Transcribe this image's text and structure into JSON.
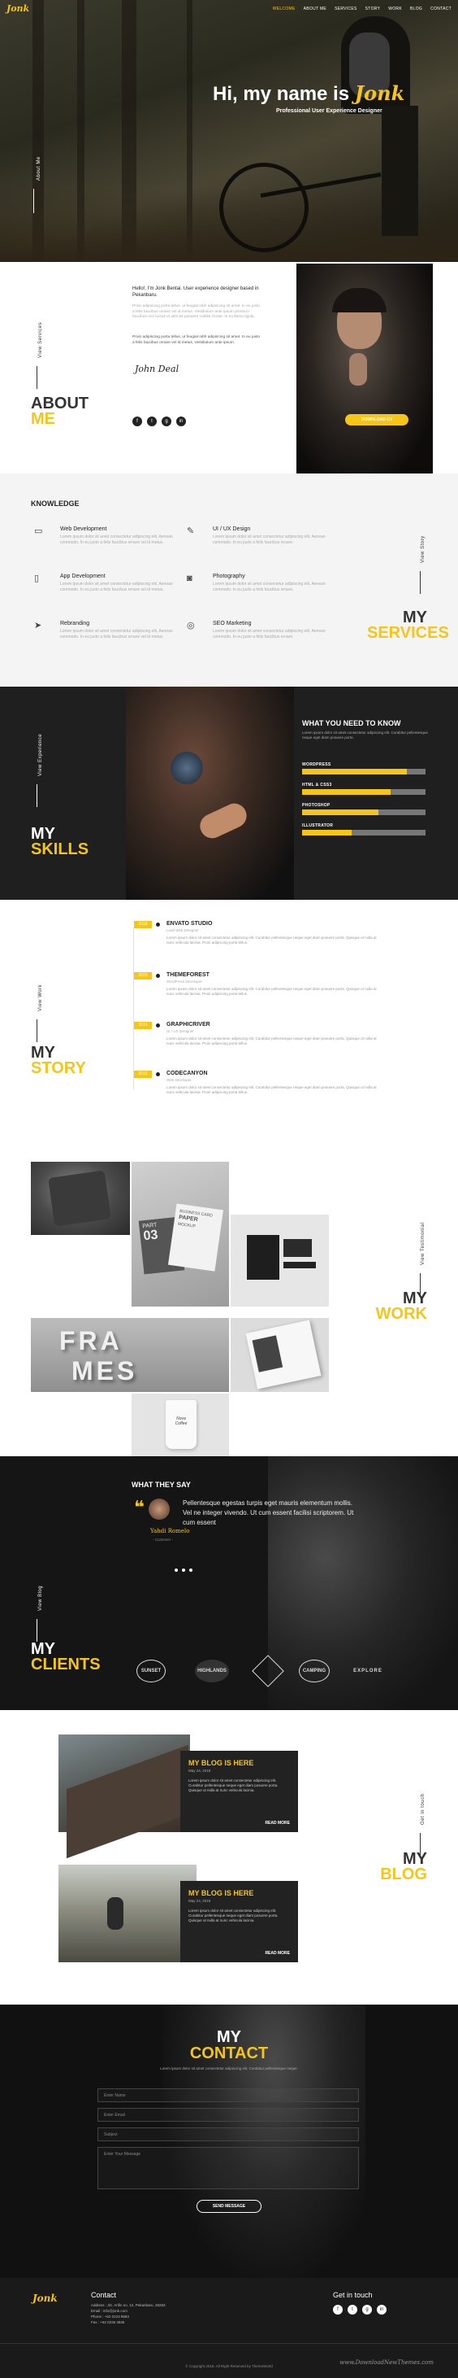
{
  "nav": {
    "logo": "Jonk",
    "items": [
      "WELCOME",
      "ABOUT ME",
      "SERVICES",
      "STORY",
      "WORK",
      "BLOG",
      "CONTACT"
    ]
  },
  "hero": {
    "greeting": "Hi, my name is",
    "name": "Jonk",
    "subtitle": "Professional User Experience Designer",
    "side_label": "About Me"
  },
  "about": {
    "side_label": "View Services",
    "title_line1": "ABOUT",
    "title_line2": "ME",
    "intro": "Hello!, I'm Jonk Bentai. User experience designer based in Pekanbaru.",
    "para1": "Proin adipiscing porta tellus, ut feugiat nibh adipiscing sit amet. In eu justo a felis faucibus ornare vel id metus. Vestibulum ante ipsum primis in faucibus orci luctus et ultrices posuere cubilia Curae; In eu libero ligula.",
    "para2": "Proin adipiscing porta tellus, ut feugiat nibh adipiscing sit amet. In eu justo a felis faucibus ornare vel id metus. Vestibulum ante ipsum.",
    "signature": "John Deal",
    "socials": [
      "f",
      "t",
      "g",
      "in"
    ],
    "button": "DOWNLOAD CV"
  },
  "services": {
    "heading": "KNOWLEDGE",
    "side_label": "View Story",
    "title_line1": "MY",
    "title_line2": "SERVICES",
    "items": [
      {
        "icon": "monitor-icon",
        "glyph": "▭",
        "title": "Web Development",
        "desc": "Lorem ipsum dolor sit amet consectetur adipiscing elit, Aenean commodo. In eu justo a felis faucibus ornare vel id metus."
      },
      {
        "icon": "pen-icon",
        "glyph": "✎",
        "title": "UI / UX Design",
        "desc": "Lorem ipsum dolor sit amet consectetur adipiscing elit, Aenean commodo. In eu justo a felis faucibus ornare."
      },
      {
        "icon": "mobile-icon",
        "glyph": "▯",
        "title": "App Development",
        "desc": "Lorem ipsum dolor sit amet consectetur adipiscing elit, Aenean commodo. In eu justo a felis faucibus ornare vel id metus."
      },
      {
        "icon": "camera-icon",
        "glyph": "◙",
        "title": "Photography",
        "desc": "Lorem ipsum dolor sit amet consectetur adipiscing elit, Aenean commodo. In eu justo a felis faucibus ornare."
      },
      {
        "icon": "paper-plane-icon",
        "glyph": "➤",
        "title": "Rebranding",
        "desc": "Lorem ipsum dolor sit amet consectetur adipiscing elit, Aenean commodo. In eu justo a felis faucibus ornare vel id metus."
      },
      {
        "icon": "lifebuoy-icon",
        "glyph": "◎",
        "title": "SEO Marketing",
        "desc": "Lorem ipsum dolor sit amet consectetur adipiscing elit, Aenean commodo. In eu justo a felis faucibus ornare."
      }
    ]
  },
  "skills": {
    "side_label": "View Experience",
    "title_line1": "MY",
    "title_line2": "SKILLS",
    "heading": "WHAT YOU NEED TO KNOW",
    "intro": "Lorem ipsum dolor sit amet consectetur adipiscing elit. Curabitur pellentesque neque eget diam posuere porta.",
    "bars": [
      {
        "label": "WORDPRESS",
        "value": 0.85
      },
      {
        "label": "HTML & CSS3",
        "value": 0.72
      },
      {
        "label": "PHOTOSHOP",
        "value": 0.62
      },
      {
        "label": "ILLUSTRATOR",
        "value": 0.4
      }
    ]
  },
  "story": {
    "side_label": "View Work",
    "title_line1": "MY",
    "title_line2": "STORY",
    "items": [
      {
        "year": "2018",
        "title": "ENVATO STUDIO",
        "sub": "Lead Web Designer",
        "desc": "Lorem ipsum dolor sit amet consectetur adipiscing elit. Curabitur pellentesque neque eget diam posuere porta. Quisque ut nulla at nunc vehicula lacinia. Proin adipiscing porta tellus."
      },
      {
        "year": "2016",
        "title": "THEMEFOREST",
        "sub": "WordPress Developer",
        "desc": "Lorem ipsum dolor sit amet consectetur adipiscing elit. Curabitur pellentesque neque eget diam posuere porta. Quisque ut nulla at nunc vehicula lacinia. Proin adipiscing porta tellus."
      },
      {
        "year": "2014",
        "title": "GRAPHICRIVER",
        "sub": "UI / UX Designer",
        "desc": "Lorem ipsum dolor sit amet consectetur adipiscing elit. Curabitur pellentesque neque eget diam posuere porta. Quisque ut nulla at nunc vehicula lacinia. Proin adipiscing porta tellus."
      },
      {
        "year": "2012",
        "title": "CODECANYON",
        "sub": "Web Developer",
        "desc": "Lorem ipsum dolor sit amet consectetur adipiscing elit. Curabitur pellentesque neque eget diam posuere porta. Quisque ut nulla at nunc vehicula lacinia. Proin adipiscing porta tellus."
      }
    ]
  },
  "work": {
    "side_label": "View Testimonial",
    "title_line1": "MY",
    "title_line2": "WORK",
    "mockup_part": "PART",
    "mockup_num": "03",
    "mockup_card": "BUSINESS CARD",
    "mockup_paper": "PAPER",
    "mockup_mockup": "MOCKUP",
    "frames_line1": "FRA",
    "frames_line2": "MES",
    "cup_text": "Nova Coffee"
  },
  "clients": {
    "side_label": "View Blog",
    "title_line1": "MY",
    "title_line2": "CLIENTS",
    "heading": "WHAT THEY SAY",
    "quote": "Pellentesque egestas turpis eget mauris elementum mollis. Vel ne integer vivendo. Ut cum essent facilisi scriptorem. Ut cum essent",
    "author": "Yahdi Romelo",
    "role": "- Customer -",
    "logos": [
      "SUNSET",
      "HIGHLANDS",
      "",
      "CAMPING",
      "EXPLORE"
    ]
  },
  "blog": {
    "side_label": "Get in touch",
    "title_line1": "MY",
    "title_line2": "BLOG",
    "posts": [
      {
        "title": "MY BLOG IS HERE",
        "date": "May 24, 2018",
        "text": "Lorem ipsum dolor sit amet consectetur adipiscing elit. Curabitur pellentesque neque eget diam posuere porta. Quisque ut nulla at nunc vehicula lacinia.",
        "more": "READ MORE"
      },
      {
        "title": "MY BLOG IS HERE",
        "date": "May 24, 2018",
        "text": "Lorem ipsum dolor sit amet consectetur adipiscing elit. Curabitur pellentesque neque eget diam posuere porta. Quisque ut nulla at nunc vehicula lacinia.",
        "more": "READ MORE"
      }
    ]
  },
  "contact": {
    "title_line1": "MY",
    "title_line2": "CONTACT",
    "intro": "Lorem ipsum dolor sit amet consectetur adipiscing elit. Curabitur pellentesque neque.",
    "name_ph": "Enter Name",
    "email_ph": "Enter Email",
    "subject_ph": "Subject",
    "message_ph": "Enter Your Message",
    "send": "SEND MESSAGE"
  },
  "footer": {
    "logo": "Jonk",
    "contact_heading": "Contact",
    "address": "Address : Jln. Arifin no. 12, Pekanbaru, 28283",
    "email": "Email : info@jonk.com",
    "phone": "Phone : +62 0123 9583",
    "fax": "Fax : +62 0236 3836",
    "touch_heading": "Get in touch",
    "copyright": "© Copyright 2018. All Right Reserved by ThemeWorld",
    "watermark": "www.DownloadNewThemes.com"
  },
  "colors": {
    "accent": "#f5c518",
    "dark": "#1f1f1f"
  }
}
